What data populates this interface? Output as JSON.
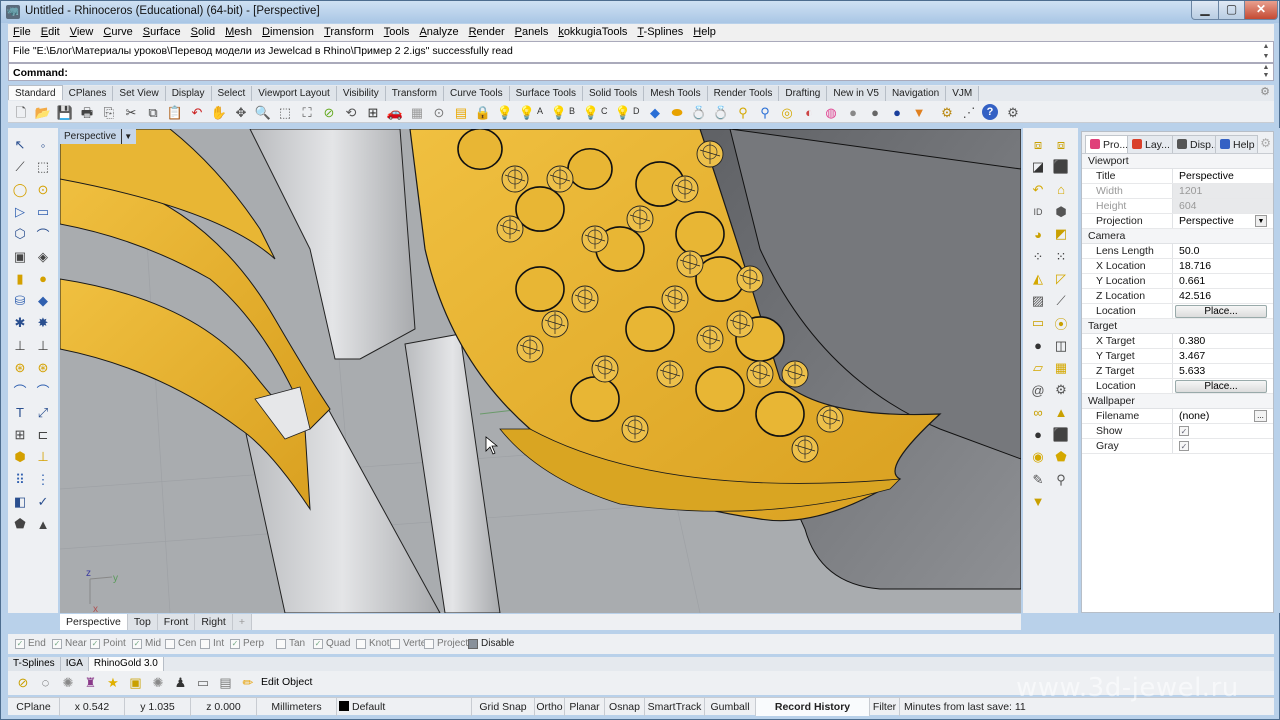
{
  "window": {
    "title": "Untitled - Rhinoceros (Educational) (64-bit) - [Perspective]",
    "controls": {
      "minimize": "▁",
      "maximize": "▢",
      "close": "✕"
    }
  },
  "menu": [
    "File",
    "Edit",
    "View",
    "Curve",
    "Surface",
    "Solid",
    "Mesh",
    "Dimension",
    "Transform",
    "Tools",
    "Analyze",
    "Render",
    "Panels",
    "kokkugiaTools",
    "T-Splines",
    "Help"
  ],
  "command_history": "File \"E:\\Блог\\Материалы уроков\\Перевод модели из Jewelcad в Rhino\\Пример 2 2.igs\" successfully read",
  "command_prompt": "Command:",
  "toolbar_tabs": [
    "Standard",
    "CPlanes",
    "Set View",
    "Display",
    "Select",
    "Viewport Layout",
    "Visibility",
    "Transform",
    "Curve Tools",
    "Surface Tools",
    "Solid Tools",
    "Mesh Tools",
    "Render Tools",
    "Drafting",
    "New in V5",
    "Navigation",
    "VJM"
  ],
  "active_toolbar_tab": "Standard",
  "standard_tools": [
    {
      "name": "new-icon",
      "glyph": "🗋",
      "color": "#555"
    },
    {
      "name": "open-icon",
      "glyph": "📂",
      "color": "#d9a520"
    },
    {
      "name": "save-icon",
      "glyph": "💾",
      "color": "#3a4a5a"
    },
    {
      "name": "print-icon",
      "glyph": "🖶",
      "color": "#444"
    },
    {
      "name": "import-icon",
      "glyph": "⎘",
      "color": "#555"
    },
    {
      "name": "cut-icon",
      "glyph": "✂",
      "color": "#444"
    },
    {
      "name": "copy-icon",
      "glyph": "⧉",
      "color": "#444"
    },
    {
      "name": "paste-icon",
      "glyph": "📋",
      "color": "#d8b400"
    },
    {
      "name": "undo-icon",
      "glyph": "↶",
      "color": "#c22"
    },
    {
      "name": "pan-icon",
      "glyph": "✋",
      "color": "#555"
    },
    {
      "name": "rotate-view-icon",
      "glyph": "✥",
      "color": "#555"
    },
    {
      "name": "zoom-icon",
      "glyph": "🔍",
      "color": "#555"
    },
    {
      "name": "zoom-window-icon",
      "glyph": "⬚",
      "color": "#555"
    },
    {
      "name": "zoom-extents-icon",
      "glyph": "⛶",
      "color": "#555"
    },
    {
      "name": "zoom-selected-icon",
      "glyph": "⊘",
      "color": "#6a2"
    },
    {
      "name": "undo-view-icon",
      "glyph": "⟲",
      "color": "#555"
    },
    {
      "name": "four-views-icon",
      "glyph": "⊞",
      "color": "#333"
    },
    {
      "name": "car-icon",
      "glyph": "🚗",
      "color": "#c22"
    },
    {
      "name": "grid-icon",
      "glyph": "▦",
      "color": "#999"
    },
    {
      "name": "osnap-icon",
      "glyph": "⊙",
      "color": "#777"
    },
    {
      "name": "properties-icon",
      "glyph": "▤",
      "color": "#e9a800"
    },
    {
      "name": "lock-icon",
      "glyph": "🔒",
      "color": "#444"
    },
    {
      "name": "light-icon",
      "glyph": "💡",
      "color": "#777"
    },
    {
      "name": "light-a-icon",
      "glyph": "💡",
      "color": "#c9a800",
      "label": "A"
    },
    {
      "name": "light-b-icon",
      "glyph": "💡",
      "color": "#c9a800",
      "label": "B"
    },
    {
      "name": "light-c-icon",
      "glyph": "💡",
      "color": "#c9a800",
      "label": "C"
    },
    {
      "name": "light-d-icon",
      "glyph": "💡",
      "color": "#c9a800",
      "label": "D"
    },
    {
      "name": "gem-blue-icon",
      "glyph": "◆",
      "color": "#2a6fd6"
    },
    {
      "name": "gem-flat-icon",
      "glyph": "⬬",
      "color": "#e8a200"
    },
    {
      "name": "ring-icon",
      "glyph": "💍",
      "color": "#d4a800"
    },
    {
      "name": "ring-outline-icon",
      "glyph": "💍",
      "color": "#888"
    },
    {
      "name": "pin-icon",
      "glyph": "⚲",
      "color": "#d4a800"
    },
    {
      "name": "pin2-icon",
      "glyph": "⚲",
      "color": "#2a6fd6"
    },
    {
      "name": "band-icon",
      "glyph": "◎",
      "color": "#d4a800"
    },
    {
      "name": "render-icon",
      "glyph": "◐",
      "color": "#c44"
    },
    {
      "name": "color-wheel-icon",
      "glyph": "◍",
      "color": "#e04090"
    },
    {
      "name": "sphere-gray-icon",
      "glyph": "●",
      "color": "#888"
    },
    {
      "name": "sphere-gray2-icon",
      "glyph": "●",
      "color": "#666"
    },
    {
      "name": "sphere-blue-icon",
      "glyph": "●",
      "color": "#1b3f9c"
    },
    {
      "name": "cone-icon",
      "glyph": "▼",
      "color": "#e08020"
    },
    {
      "name": "options-icon",
      "glyph": "⚙",
      "color": "#b8860b"
    },
    {
      "name": "points-icon",
      "glyph": "⋰",
      "color": "#555"
    },
    {
      "name": "help-icon",
      "glyph": "?",
      "color": "#fff",
      "bg": "#3461c4"
    },
    {
      "name": "toolbar-options-icon",
      "glyph": "⚙",
      "color": "#555"
    }
  ],
  "left_tools": [
    {
      "name": "select-icon",
      "glyph": "↖"
    },
    {
      "name": "point-icon",
      "glyph": "◦"
    },
    {
      "name": "polyline-icon",
      "glyph": "⟋"
    },
    {
      "name": "curve-cv-icon",
      "glyph": "⬚"
    },
    {
      "name": "circle-icon",
      "glyph": "◯"
    },
    {
      "name": "ellipse-icon",
      "glyph": "⊙"
    },
    {
      "name": "polygon-icon",
      "glyph": "▷"
    },
    {
      "name": "rectangle-icon",
      "glyph": "▭"
    },
    {
      "name": "arc-icon",
      "glyph": "⬡"
    },
    {
      "name": "fillet-curve-icon",
      "glyph": "⌒"
    },
    {
      "name": "surface-plane-icon",
      "glyph": "▣"
    },
    {
      "name": "surface-edge-icon",
      "glyph": "◈"
    },
    {
      "name": "solid-box-icon",
      "glyph": "▮"
    },
    {
      "name": "solid-sphere-icon",
      "glyph": "●"
    },
    {
      "name": "extrude-icon",
      "glyph": "⛁"
    },
    {
      "name": "mesh-icon",
      "glyph": "◆"
    },
    {
      "name": "boolean-union-icon",
      "glyph": "✱"
    },
    {
      "name": "explode-icon",
      "glyph": "✸"
    },
    {
      "name": "trim-icon",
      "glyph": "⊥"
    },
    {
      "name": "split-icon",
      "glyph": "⊥"
    },
    {
      "name": "group-icon",
      "glyph": "⊛"
    },
    {
      "name": "ungroup-icon",
      "glyph": "⊛"
    },
    {
      "name": "fillet-icon",
      "glyph": "⌒"
    },
    {
      "name": "offset-icon",
      "glyph": "⌒"
    },
    {
      "name": "text-icon",
      "glyph": "T"
    },
    {
      "name": "transform-icon",
      "glyph": "⤢"
    },
    {
      "name": "array-icon",
      "glyph": "⊞"
    },
    {
      "name": "align-icon",
      "glyph": "⊏"
    },
    {
      "name": "cage-icon",
      "glyph": "⬢"
    },
    {
      "name": "dimension-icon",
      "glyph": "⊥"
    },
    {
      "name": "grid-array-icon",
      "glyph": "⠿"
    },
    {
      "name": "history-icon",
      "glyph": "⋮"
    },
    {
      "name": "analyze-icon",
      "glyph": "◧"
    },
    {
      "name": "check-icon",
      "glyph": "✓"
    },
    {
      "name": "render-solid-icon",
      "glyph": "⬟"
    },
    {
      "name": "pyramid-icon",
      "glyph": "▲"
    }
  ],
  "right_tools": [
    {
      "name": "layout-icon",
      "glyph": "⧈"
    },
    {
      "name": "layout2-icon",
      "glyph": "⧈"
    },
    {
      "name": "contrast-icon",
      "glyph": "◪"
    },
    {
      "name": "box-yellow-icon",
      "glyph": "⬛"
    },
    {
      "name": "rotate-back-icon",
      "glyph": "↶"
    },
    {
      "name": "tag-icon",
      "glyph": "⌂"
    },
    {
      "name": "id-icon",
      "glyph": "ID"
    },
    {
      "name": "box3d-icon",
      "glyph": "⬢"
    },
    {
      "name": "rgb-icon",
      "glyph": "◕"
    },
    {
      "name": "shell-icon",
      "glyph": "◩"
    },
    {
      "name": "cluster-icon",
      "glyph": "⁘"
    },
    {
      "name": "dots-icon",
      "glyph": "⁙"
    },
    {
      "name": "solids-icon",
      "glyph": "◭"
    },
    {
      "name": "cone2-icon",
      "glyph": "◸"
    },
    {
      "name": "pattern-icon",
      "glyph": "▨"
    },
    {
      "name": "polyline2-icon",
      "glyph": "⟋"
    },
    {
      "name": "folder-icon",
      "glyph": "▭"
    },
    {
      "name": "balls-icon",
      "glyph": "⦿"
    },
    {
      "name": "black-sphere-icon",
      "glyph": "●"
    },
    {
      "name": "open-box-icon",
      "glyph": "◫"
    },
    {
      "name": "plane-icon",
      "glyph": "▱"
    },
    {
      "name": "grid-panel-icon",
      "glyph": "▦"
    },
    {
      "name": "spiral-icon",
      "glyph": "@"
    },
    {
      "name": "gear-plate-icon",
      "glyph": "⚙"
    },
    {
      "name": "chain-icon",
      "glyph": "∞"
    },
    {
      "name": "pyramid2-icon",
      "glyph": "▲"
    },
    {
      "name": "gray-sphere-icon",
      "glyph": "●"
    },
    {
      "name": "cube-icon",
      "glyph": "⬛"
    },
    {
      "name": "medal-icon",
      "glyph": "◉"
    },
    {
      "name": "mixed-shapes-icon",
      "glyph": "⬟"
    },
    {
      "name": "brush-icon",
      "glyph": "✎"
    },
    {
      "name": "magnifier-icon",
      "glyph": "⚲"
    },
    {
      "name": "filter-icon",
      "glyph": "▼"
    }
  ],
  "viewport": {
    "label": "Perspective",
    "colors": {
      "background": "#a9acaf",
      "gold": "#e8b634",
      "gold_dark": "#c89418",
      "gray_surface": "#d8d9db",
      "dark_surface": "#6a6c70",
      "edge": "#1a1a1a"
    },
    "axes": {
      "z": "z",
      "y": "y",
      "x": "x"
    }
  },
  "viewport_tabs": [
    "Perspective",
    "Top",
    "Front",
    "Right"
  ],
  "active_viewport_tab": "Perspective",
  "add_viewport_tab": "+",
  "osnaps": [
    {
      "label": "End",
      "checked": true
    },
    {
      "label": "Near",
      "checked": true
    },
    {
      "label": "Point",
      "checked": true
    },
    {
      "label": "Mid",
      "checked": true
    },
    {
      "label": "Cen",
      "checked": false
    },
    {
      "label": "Int",
      "checked": false
    },
    {
      "label": "Perp",
      "checked": true
    },
    {
      "label": "Tan",
      "checked": false
    },
    {
      "label": "Quad",
      "checked": true
    },
    {
      "label": "Knot",
      "checked": false
    },
    {
      "label": "Vertex",
      "checked": false
    },
    {
      "label": "Project",
      "checked": false
    }
  ],
  "osnap_disable": "Disable",
  "plugin_tabs": [
    "T-Splines",
    "IGA",
    "RhinoGold 3.0"
  ],
  "active_plugin_tab": "RhinoGold 3.0",
  "plugin_tools": [
    {
      "name": "compass-icon",
      "glyph": "⊘",
      "color": "#c9a000"
    },
    {
      "name": "ring-sizer-icon",
      "glyph": "◌",
      "color": "#333"
    },
    {
      "name": "gem-studio-icon",
      "glyph": "✺",
      "color": "#888"
    },
    {
      "name": "prongs-icon",
      "glyph": "♜",
      "color": "#8a3a8a"
    },
    {
      "name": "star-icon",
      "glyph": "★",
      "color": "#e0b000"
    },
    {
      "name": "text-ring-icon",
      "glyph": "▣",
      "color": "#c9a000"
    },
    {
      "name": "pave-icon",
      "glyph": "✺",
      "color": "#888"
    },
    {
      "name": "cam-icon",
      "glyph": "♟",
      "color": "#333"
    },
    {
      "name": "frame-icon",
      "glyph": "▭",
      "color": "#666"
    },
    {
      "name": "printer-icon",
      "glyph": "▤",
      "color": "#777"
    },
    {
      "name": "pencil-icon",
      "glyph": "✏",
      "color": "#e8a000"
    }
  ],
  "plugin_edit_label": "Edit Object",
  "status": {
    "cplane": "CPlane",
    "x": "x 0.542",
    "y": "y 1.035",
    "z": "z 0.000",
    "units": "Millimeters",
    "layer": "Default",
    "layer_color": "#000000",
    "toggles": [
      "Grid Snap",
      "Ortho",
      "Planar",
      "Osnap",
      "SmartTrack",
      "Gumball",
      "Record History",
      "Filter"
    ],
    "active_toggle": "Record History",
    "save_info": "Minutes from last save: 11"
  },
  "panel": {
    "tabs": [
      {
        "label": "Pro...",
        "icon": "properties-tab-icon",
        "color": "#e0407a"
      },
      {
        "label": "Lay...",
        "icon": "layers-tab-icon",
        "color": "#d9402a"
      },
      {
        "label": "Disp...",
        "icon": "display-tab-icon",
        "color": "#555"
      },
      {
        "label": "Help",
        "icon": "help-tab-icon",
        "color": "#3461c4"
      }
    ],
    "active_tab": "Pro...",
    "sections": [
      {
        "title": "Viewport",
        "rows": [
          {
            "key": "Title",
            "value": "Perspective"
          },
          {
            "key": "Width",
            "value": "1201",
            "disabled": true
          },
          {
            "key": "Height",
            "value": "604",
            "disabled": true
          },
          {
            "key": "Projection",
            "value": "Perspective",
            "dropdown": true
          }
        ]
      },
      {
        "title": "Camera",
        "rows": [
          {
            "key": "Lens Length",
            "value": "50.0"
          },
          {
            "key": "X Location",
            "value": "18.716"
          },
          {
            "key": "Y Location",
            "value": "0.661"
          },
          {
            "key": "Z Location",
            "value": "42.516"
          },
          {
            "key": "Location",
            "button": "Place..."
          }
        ]
      },
      {
        "title": "Target",
        "rows": [
          {
            "key": "X Target",
            "value": "0.380"
          },
          {
            "key": "Y Target",
            "value": "3.467"
          },
          {
            "key": "Z Target",
            "value": "5.633"
          },
          {
            "key": "Location",
            "button": "Place..."
          }
        ]
      },
      {
        "title": "Wallpaper",
        "rows": [
          {
            "key": "Filename",
            "value": "(none)",
            "ellipsis": "..."
          },
          {
            "key": "Show",
            "checkbox": true
          },
          {
            "key": "Gray",
            "checkbox": true
          }
        ]
      }
    ]
  },
  "watermark": "www.3d-jewel.ru"
}
